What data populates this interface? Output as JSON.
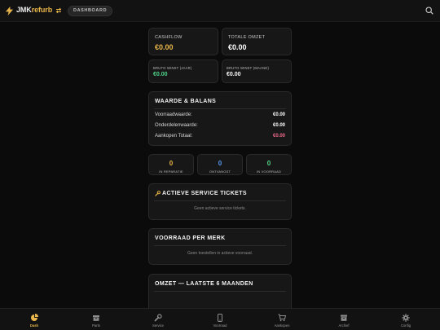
{
  "header": {
    "brand_part1": "JMK",
    "brand_part2": "refurb",
    "pill_label": "DASHBOARD",
    "icons": [
      "logo-bolt-icon",
      "swap-icon",
      "search-icon"
    ]
  },
  "stats": [
    {
      "label": "CASHFLOW",
      "value": "€0.00",
      "color": "#e8b64a"
    },
    {
      "label": "TOTALE OMZET",
      "value": "€0.00",
      "color": "#ffffff"
    },
    {
      "label": "BRUTO WINST (JAAR)",
      "value": "€0.00",
      "color": "#4fd68a"
    },
    {
      "label": "BRUTO WINST (MAAND)",
      "value": "€0.00",
      "color": "#ffffff"
    }
  ],
  "balance": {
    "title": "WAARDE & BALANS",
    "rows": [
      {
        "label": "Voorraadwaarde:",
        "value": "€0.00",
        "color": "#ffffff"
      },
      {
        "label": "Onderdelenwaarde:",
        "value": "€0.00",
        "color": "#ffffff"
      },
      {
        "label": "Aankopen Totaal:",
        "value": "€0.00",
        "color": "#f06a8c"
      }
    ]
  },
  "counters": [
    {
      "value": "0",
      "label": "IN REPARATIE",
      "color": "#e8b64a"
    },
    {
      "value": "0",
      "label": "ONTVANGST",
      "color": "#5a9cf0"
    },
    {
      "value": "0",
      "label": "IN VOORRAAD",
      "color": "#4fd68a"
    }
  ],
  "tickets": {
    "title": "ACTIEVE SERVICE TICKETS",
    "empty": "Geen actieve service tickets."
  },
  "brands": {
    "title": "VOORRAAD PER MERK",
    "empty": "Geen toestellen in actieve voorraad."
  },
  "revenue": {
    "title": "OMZET — LAATSTE 6 MAANDEN"
  },
  "colors": {
    "accent": "#e8b64a",
    "background": "#0b0b0b",
    "card": "#171717"
  },
  "nav": [
    {
      "label": "Dash",
      "icon": "pie-chart-icon",
      "active": true
    },
    {
      "label": "Parts",
      "icon": "box-icon",
      "active": false
    },
    {
      "label": "Service",
      "icon": "wrench-icon",
      "active": false
    },
    {
      "label": "Voorraad",
      "icon": "phone-icon",
      "active": false
    },
    {
      "label": "Aankopen",
      "icon": "cart-icon",
      "active": false
    },
    {
      "label": "Archief",
      "icon": "archive-icon",
      "active": false
    },
    {
      "label": "Config",
      "icon": "gear-icon",
      "active": false
    }
  ]
}
